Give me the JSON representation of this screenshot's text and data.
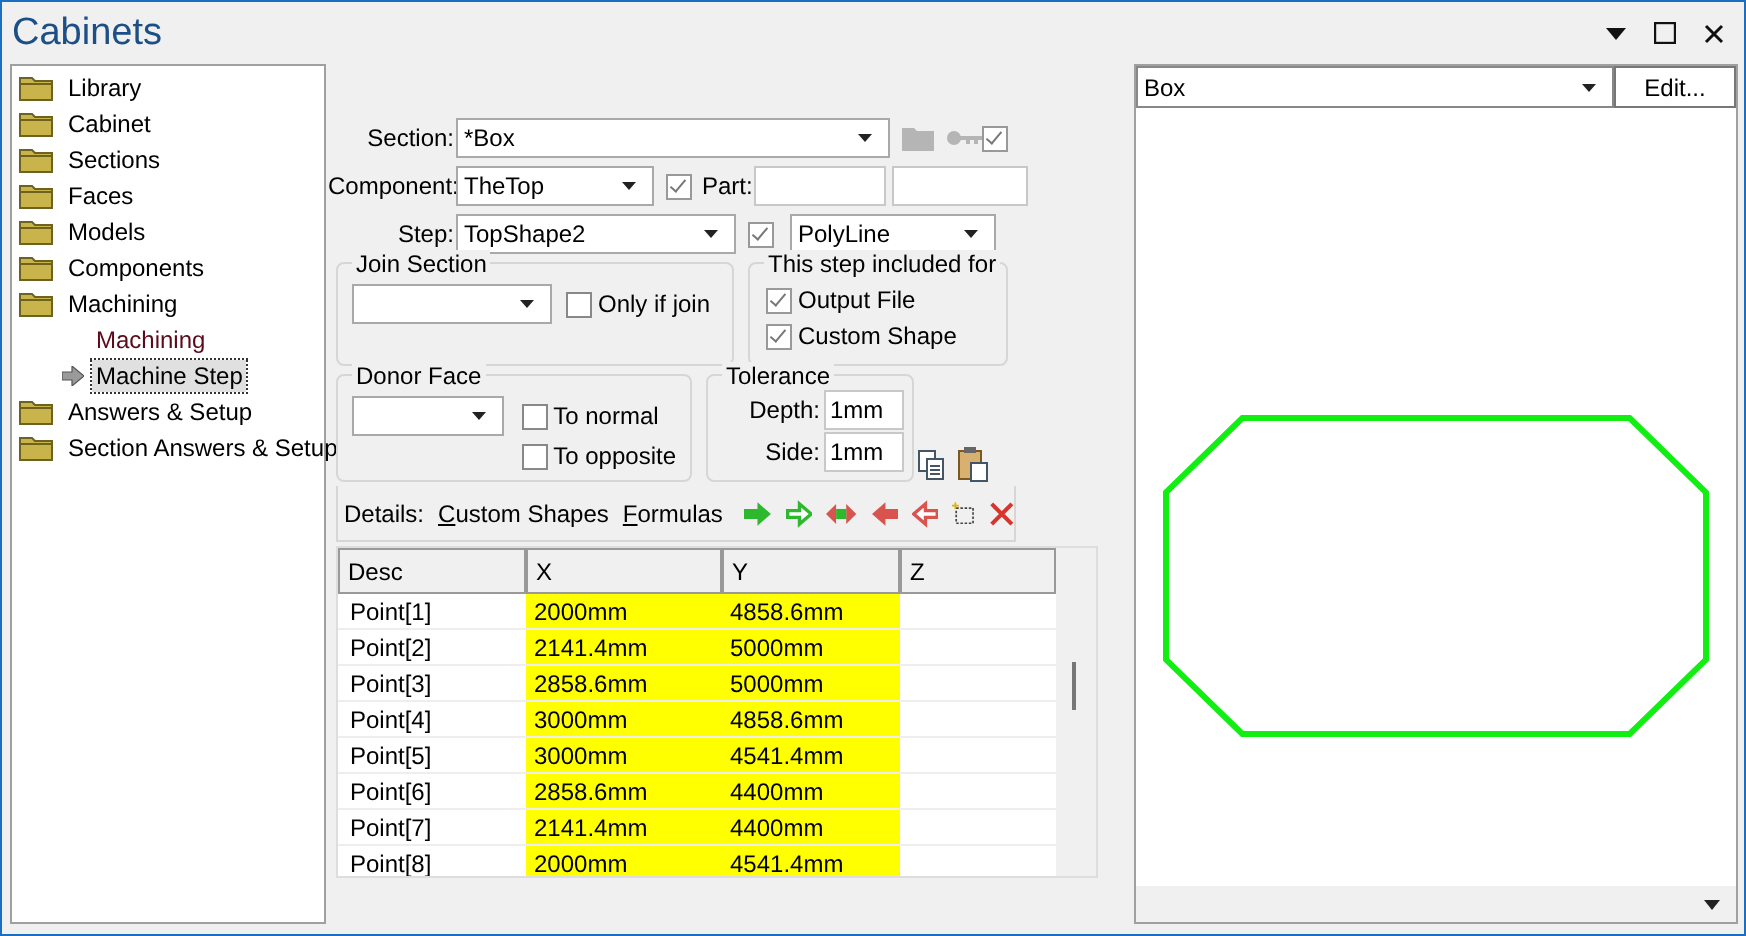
{
  "window": {
    "title": "Cabinets"
  },
  "tree": [
    {
      "label": "Library"
    },
    {
      "label": "Cabinet"
    },
    {
      "label": "Sections"
    },
    {
      "label": "Faces"
    },
    {
      "label": "Models"
    },
    {
      "label": "Components"
    },
    {
      "label": "Machining",
      "children": [
        {
          "label": "Machining",
          "selected": false
        },
        {
          "label": "Machine Step",
          "selected": true
        }
      ]
    },
    {
      "label": "Answers & Setup"
    },
    {
      "label": "Section Answers & Setup"
    }
  ],
  "form": {
    "section": {
      "label": "Section:",
      "value": "*Box",
      "checked": true
    },
    "component": {
      "label": "Component:",
      "value": "TheTop",
      "checked": true,
      "part_label": "Part:"
    },
    "step": {
      "label": "Step:",
      "value": "TopShape2",
      "checked": true,
      "type": "PolyLine"
    },
    "join_section": {
      "title": "Join Section",
      "option": {
        "label": "Only if join",
        "checked": false
      }
    },
    "included_for": {
      "title": "This step included for",
      "options": [
        {
          "label": "Output File",
          "checked": true
        },
        {
          "label": "Custom Shape",
          "checked": true
        }
      ]
    },
    "donor_face": {
      "title": "Donor Face",
      "options": [
        {
          "label": "To normal",
          "checked": false
        },
        {
          "label": "To opposite",
          "checked": false
        }
      ]
    },
    "tolerance": {
      "title": "Tolerance",
      "fields": [
        {
          "label": "Depth:",
          "value": "1mm"
        },
        {
          "label": "Side:",
          "value": "1mm"
        }
      ]
    }
  },
  "details": {
    "label": "Details:",
    "links": [
      "Custom Shapes",
      "Formulas"
    ]
  },
  "table": {
    "columns": [
      "Desc",
      "X",
      "Y",
      "Z"
    ],
    "rows": [
      [
        "Point[1]",
        "2000mm",
        "4858.6mm"
      ],
      [
        "Point[2]",
        "2141.4mm",
        "5000mm"
      ],
      [
        "Point[3]",
        "2858.6mm",
        "5000mm"
      ],
      [
        "Point[4]",
        "3000mm",
        "4858.6mm"
      ],
      [
        "Point[5]",
        "3000mm",
        "4541.4mm"
      ],
      [
        "Point[6]",
        "2858.6mm",
        "4400mm"
      ],
      [
        "Point[7]",
        "2141.4mm",
        "4400mm"
      ],
      [
        "Point[8]",
        "2000mm",
        "4541.4mm"
      ]
    ]
  },
  "preview": {
    "value": "Box",
    "button": "Edit..."
  }
}
